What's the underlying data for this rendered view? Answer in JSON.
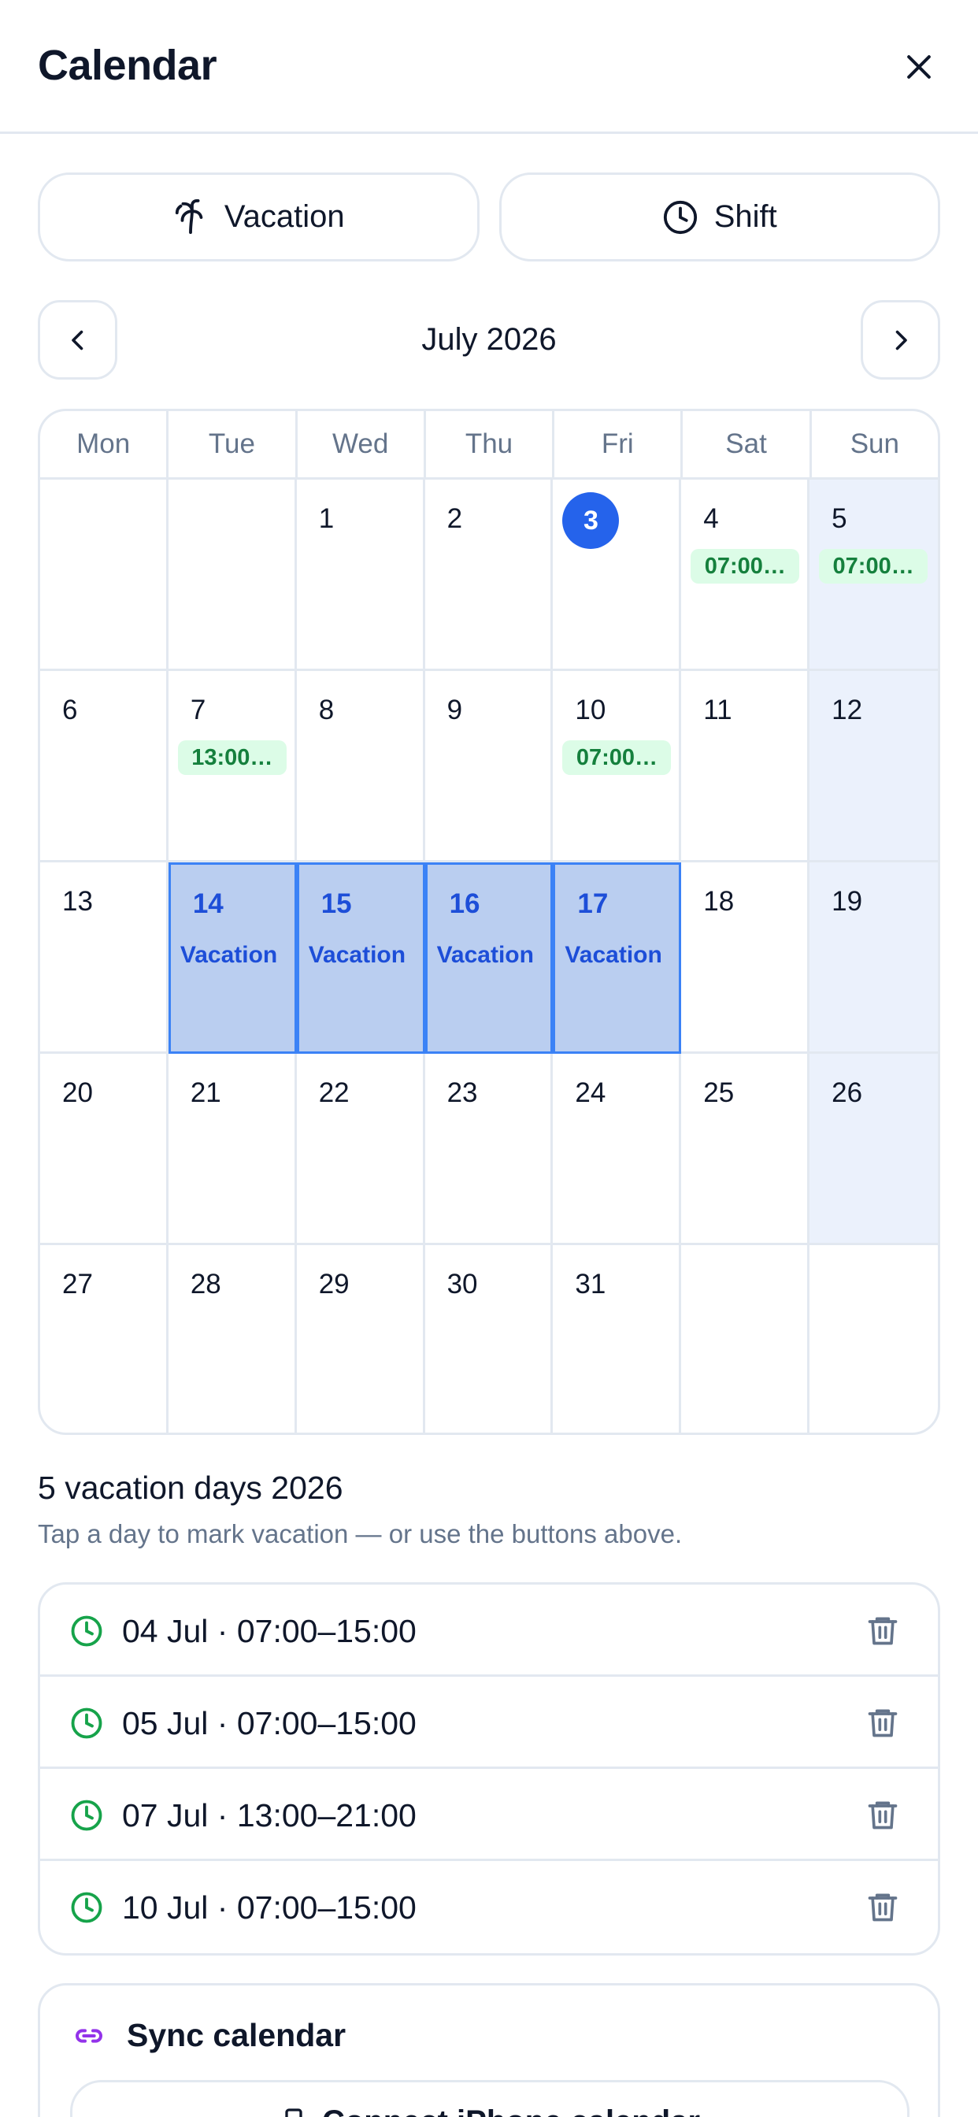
{
  "header": {
    "title": "Calendar"
  },
  "actions": {
    "vacation_label": "Vacation",
    "shift_label": "Shift"
  },
  "month": {
    "label": "July 2026"
  },
  "weekdays": [
    "Mon",
    "Tue",
    "Wed",
    "Thu",
    "Fri",
    "Sat",
    "Sun"
  ],
  "calendar": {
    "today": "3",
    "vacation_label": "Vacation",
    "days": {
      "d1": "1",
      "d2": "2",
      "d3": "3",
      "d4": "4",
      "d5": "5",
      "d6": "6",
      "d7": "7",
      "d8": "8",
      "d9": "9",
      "d10": "10",
      "d11": "11",
      "d12": "12",
      "d13": "13",
      "d14": "14",
      "d15": "15",
      "d16": "16",
      "d17": "17",
      "d18": "18",
      "d19": "19",
      "d20": "20",
      "d21": "21",
      "d22": "22",
      "d23": "23",
      "d24": "24",
      "d25": "25",
      "d26": "26",
      "d27": "27",
      "d28": "28",
      "d29": "29",
      "d30": "30",
      "d31": "31"
    },
    "badges": {
      "d4": "07:00…",
      "d5": "07:00…",
      "d7": "13:00…",
      "d10": "07:00…"
    }
  },
  "summary": {
    "title": "5 vacation days 2026",
    "subtitle": "Tap a day to mark vacation — or use the buttons above."
  },
  "shifts": [
    {
      "text": "04 Jul · 07:00–15:00"
    },
    {
      "text": "05 Jul · 07:00–15:00"
    },
    {
      "text": "07 Jul · 13:00–21:00"
    },
    {
      "text": "10 Jul · 07:00–15:00"
    }
  ],
  "sync": {
    "title": "Sync calendar",
    "button_label": "Connect iPhone calendar"
  },
  "colors": {
    "accent": "#2563eb",
    "vacation_bg": "#bacef0",
    "shift_badge_bg": "#dcfce7",
    "shift_badge_text": "#15803d",
    "sync_icon": "#9333ea"
  }
}
